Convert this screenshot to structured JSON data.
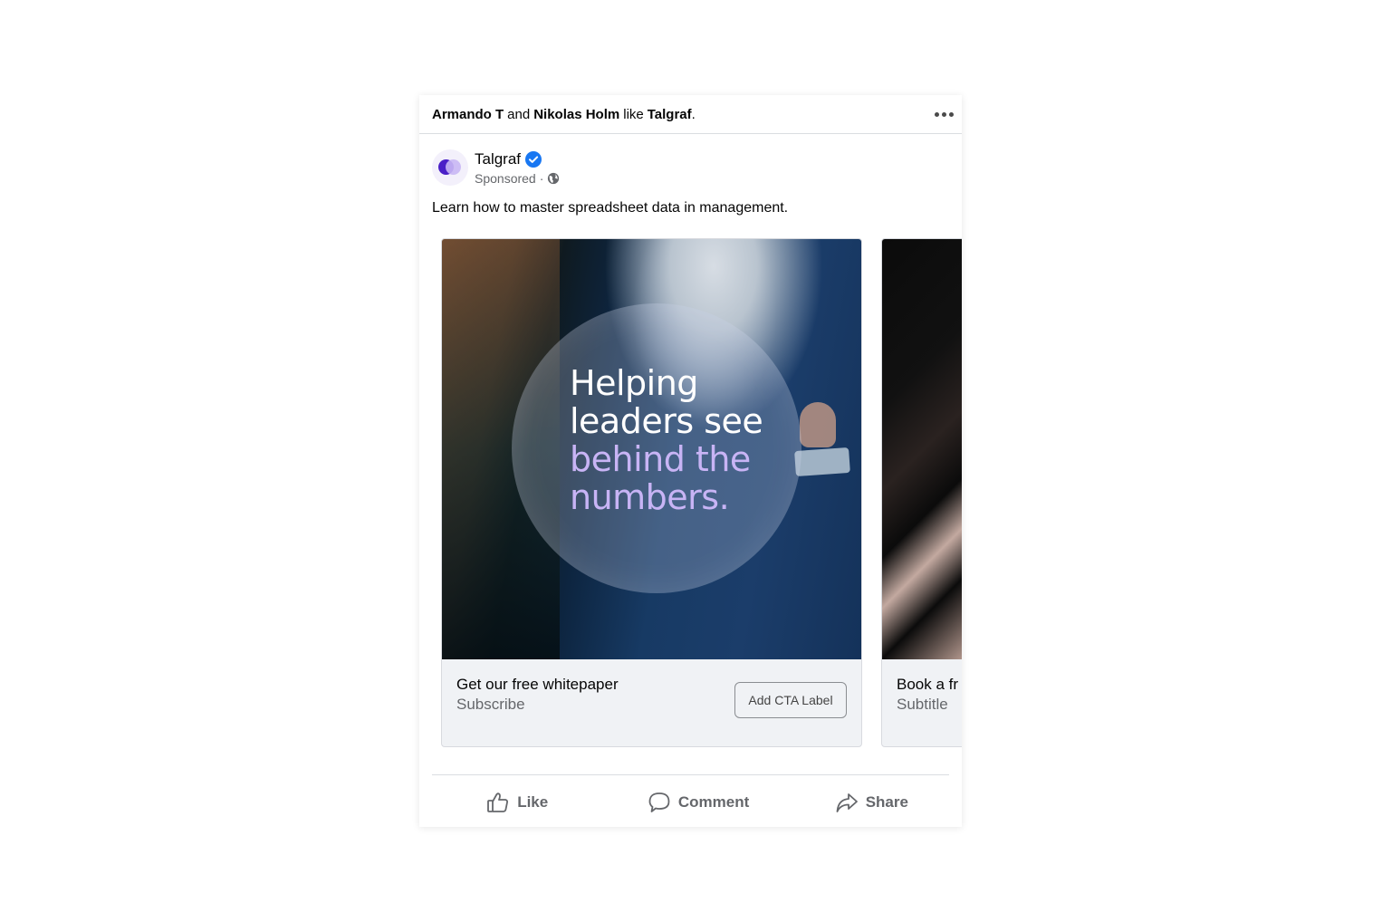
{
  "social_context": {
    "user1": "Armando T",
    "conjunction": "and",
    "user2": "Nikolas Holm",
    "verb": "like",
    "page": "Talgraf",
    "end": "."
  },
  "post": {
    "page_name": "Talgraf",
    "sponsored_label": "Sponsored",
    "separator": "·",
    "caption": "Learn how to master spreadsheet data in management."
  },
  "cards": [
    {
      "headline_lines": [
        "Helping",
        "leaders see"
      ],
      "headline_accent_lines": [
        "behind the",
        "numbers."
      ],
      "title": "Get our free whitepaper",
      "subtitle": "Subscribe",
      "cta_label": "Add CTA Label"
    },
    {
      "title": "Book a fr",
      "subtitle": "Subtitle"
    }
  ],
  "actions": {
    "like": "Like",
    "comment": "Comment",
    "share": "Share"
  },
  "colors": {
    "verified_badge": "#1877f2",
    "accent_text": "#c8b4f5",
    "muted_text": "#65676b"
  }
}
